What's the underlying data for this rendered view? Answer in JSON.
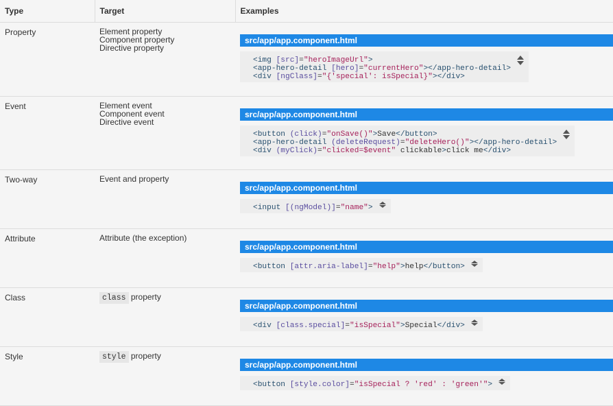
{
  "headers": {
    "type": "Type",
    "target": "Target",
    "examples": "Examples"
  },
  "rows": [
    {
      "type": "Property",
      "targets": [
        "Element property",
        "Component property",
        "Directive property"
      ],
      "filename": "src/app/app.component.html",
      "code": [
        "<img [src]=\"heroImageUrl\">",
        "<app-hero-detail [hero]=\"currentHero\"></app-hero-detail>",
        "<div [ngClass]=\"{'special': isSpecial}\"></div>"
      ]
    },
    {
      "type": "Event",
      "targets": [
        "Element event",
        "Component event",
        "Directive event"
      ],
      "filename": "src/app/app.component.html",
      "code": [
        "<button (click)=\"onSave()\">Save</button>",
        "<app-hero-detail (deleteRequest)=\"deleteHero()\"></app-hero-detail>",
        "<div (myClick)=\"clicked=$event\" clickable>click me</div>"
      ]
    },
    {
      "type": "Two-way",
      "targets": [
        "Event and property"
      ],
      "filename": "src/app/app.component.html",
      "code": [
        "<input [(ngModel)]=\"name\">"
      ]
    },
    {
      "type": "Attribute",
      "targets": [
        "Attribute (the exception)"
      ],
      "filename": "src/app/app.component.html",
      "code": [
        "<button [attr.aria-label]=\"help\">help</button>"
      ]
    },
    {
      "type": "Class",
      "target_code": "class",
      "target_suffix": " property",
      "filename": "src/app/app.component.html",
      "code": [
        "<div [class.special]=\"isSpecial\">Special</div>"
      ]
    },
    {
      "type": "Style",
      "target_code": "style",
      "target_suffix": " property",
      "filename": "src/app/app.component.html",
      "code": [
        "<button [style.color]=\"isSpecial ? 'red' : 'green'\">"
      ]
    }
  ]
}
